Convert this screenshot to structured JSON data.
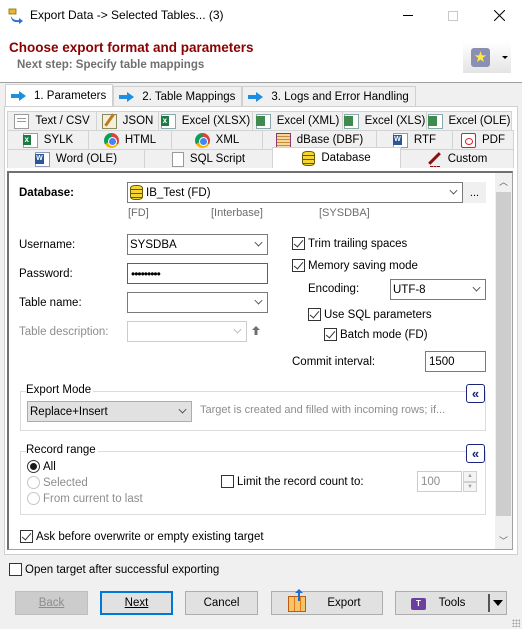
{
  "window": {
    "title": "Export Data -> Selected Tables... (3)",
    "minimize_icon": "minimize-icon",
    "maximize_icon": "maximize-icon",
    "close_icon": "close-icon"
  },
  "header": {
    "title": "Choose export format and parameters",
    "subtitle": "Next step: Specify table mappings",
    "favorites_icon": "star-icon",
    "title_color": "#8b0000"
  },
  "steps": [
    {
      "label": "1. Parameters",
      "active": true
    },
    {
      "label": "2. Table Mappings",
      "active": false
    },
    {
      "label": "3. Logs and Error Handling",
      "active": false
    }
  ],
  "formats": {
    "row1": [
      {
        "label": "Text / CSV",
        "icon": "text-file-icon"
      },
      {
        "label": "JSON",
        "icon": "json-icon"
      },
      {
        "label": "Excel (XLSX)",
        "icon": "excel-xlsx-icon"
      },
      {
        "label": "Excel (XML)",
        "icon": "excel-xml-icon"
      },
      {
        "label": "Excel (XLS)",
        "icon": "excel-xls-icon"
      },
      {
        "label": "Excel (OLE)",
        "icon": "excel-ole-icon"
      }
    ],
    "row2": [
      {
        "label": "SYLK",
        "icon": "sylk-icon"
      },
      {
        "label": "HTML",
        "icon": "chrome-icon"
      },
      {
        "label": "XML",
        "icon": "chrome-icon"
      },
      {
        "label": "dBase (DBF)",
        "icon": "dbase-icon"
      },
      {
        "label": "RTF",
        "icon": "word-icon"
      },
      {
        "label": "PDF",
        "icon": "pdf-icon"
      }
    ],
    "row3": [
      {
        "label": "Word (OLE)",
        "icon": "word-icon"
      },
      {
        "label": "SQL Script",
        "icon": "page-icon"
      },
      {
        "label": "Database",
        "icon": "database-icon",
        "active": true
      },
      {
        "label": "Custom",
        "icon": "pen-icon"
      }
    ]
  },
  "database": {
    "label": "Database:",
    "value": "IB_Test (FD)",
    "browse_label": "...",
    "info": [
      "[FD]",
      "[Interbase]",
      "[SYSDBA]"
    ]
  },
  "fields": {
    "username_label": "Username:",
    "username_value": "SYSDBA",
    "password_label": "Password:",
    "password_value": "•••••••••",
    "table_name_label": "Table name:",
    "table_name_value": "",
    "table_desc_label": "Table description:",
    "table_desc_value": ""
  },
  "options": {
    "trim_trailing_spaces": {
      "label": "Trim trailing spaces",
      "checked": true
    },
    "memory_saving_mode": {
      "label": "Memory saving mode",
      "checked": true
    },
    "encoding_label": "Encoding:",
    "encoding_value": "UTF-8",
    "use_sql_parameters": {
      "label": "Use SQL parameters",
      "checked": true
    },
    "batch_mode": {
      "label": "Batch mode (FD)",
      "checked": true
    },
    "commit_interval_label": "Commit interval:",
    "commit_interval_value": "1500"
  },
  "export_mode": {
    "title": "Export Mode",
    "value": "Replace+Insert",
    "description": "Target is created and filled with incoming rows; if...",
    "collapse_label": "«"
  },
  "record_range": {
    "title": "Record range",
    "options": [
      {
        "label": "All",
        "selected": true,
        "enabled": true
      },
      {
        "label": "Selected",
        "selected": false,
        "enabled": false
      },
      {
        "label": "From current to last",
        "selected": false,
        "enabled": false
      }
    ],
    "limit_label": "Limit the record count to:",
    "limit_checked": false,
    "limit_value": "100",
    "collapse_label": "«"
  },
  "ask_overwrite": {
    "label": "Ask before overwrite or empty existing target",
    "checked": true
  },
  "open_target": {
    "label": "Open target after successful exporting",
    "checked": false
  },
  "buttons": {
    "back": "Back",
    "next": "Next",
    "cancel": "Cancel",
    "export": "Export",
    "tools": "Tools"
  },
  "colors": {
    "accent": "#0078d7",
    "step_arrow": "#1c8fe0",
    "collapse_border": "#1a237e"
  }
}
